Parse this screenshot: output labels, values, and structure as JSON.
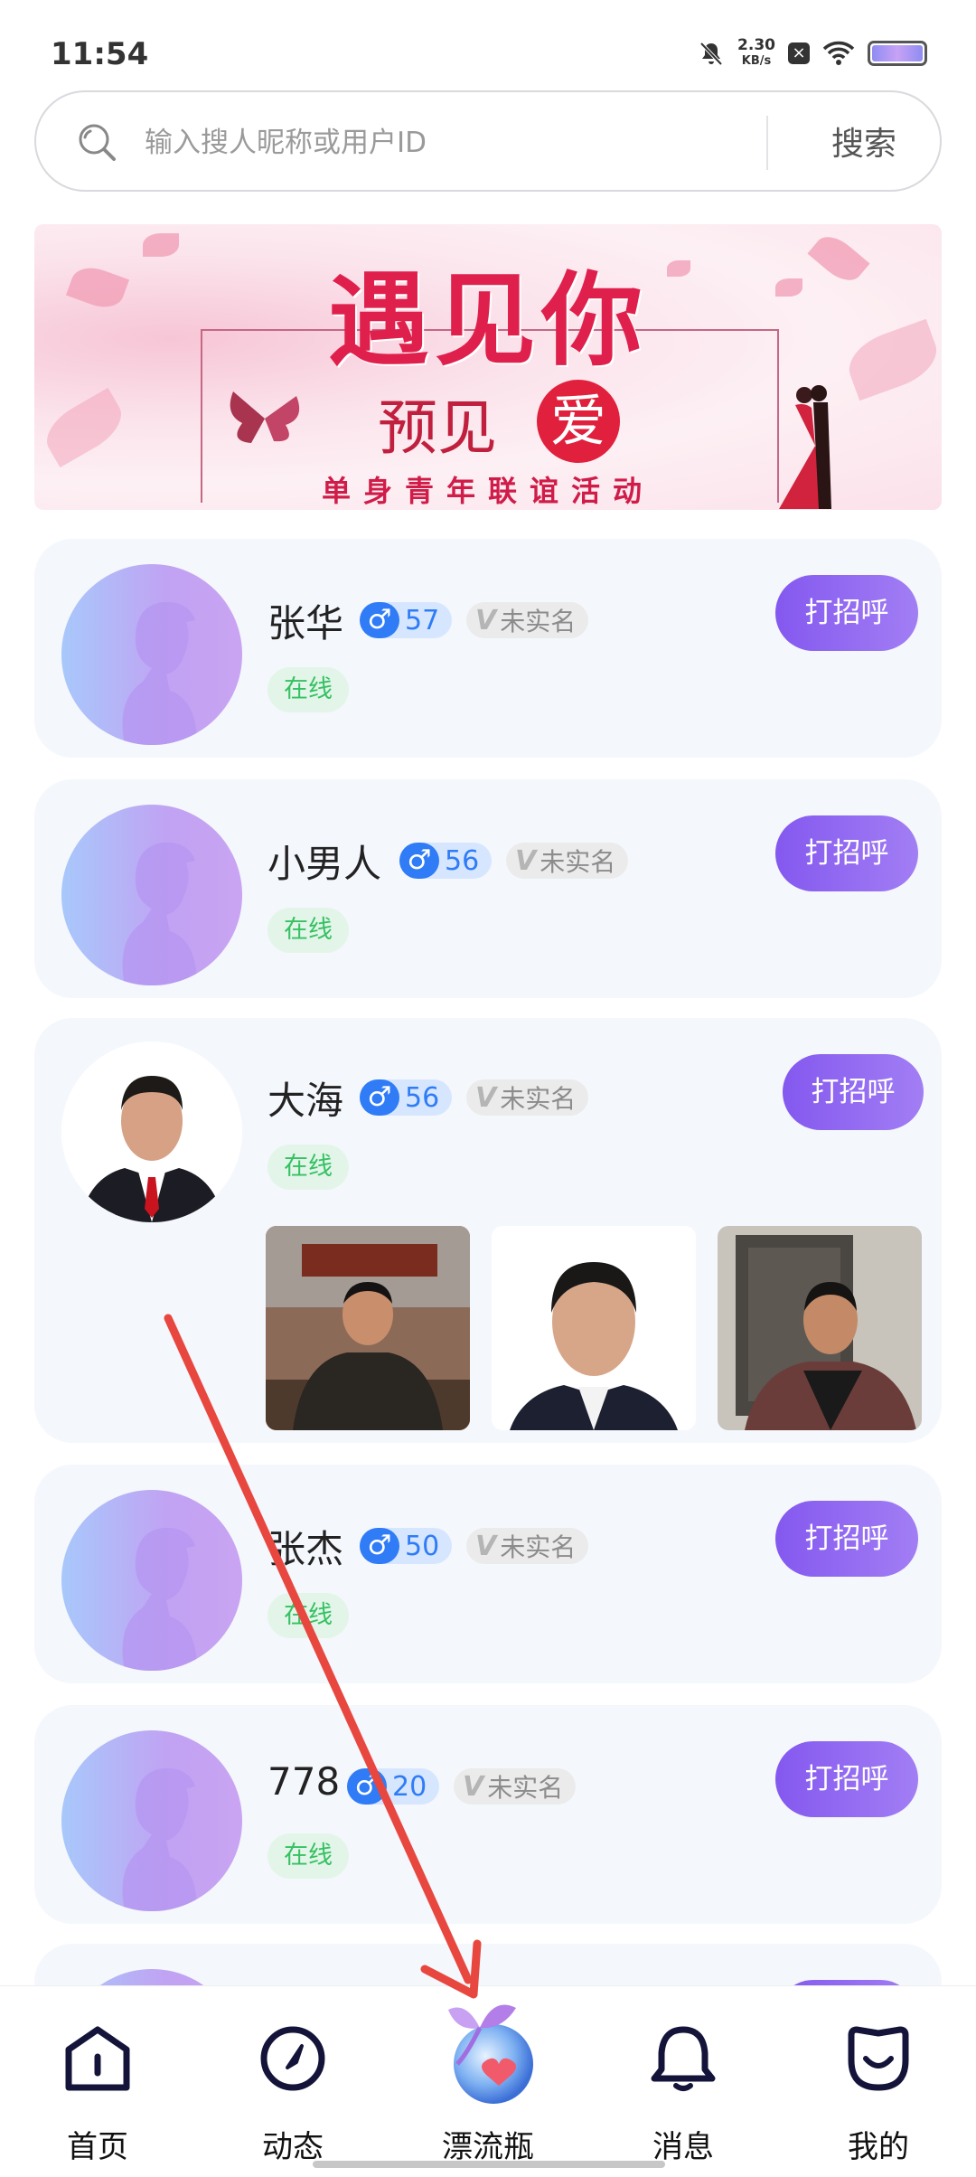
{
  "status_bar": {
    "time": "11:54",
    "net_speed_value": "2.30",
    "net_speed_unit": "KB/s"
  },
  "search": {
    "placeholder": "输入搜人昵称或用户ID",
    "button_label": "搜索"
  },
  "banner": {
    "title": "遇见你",
    "subtitle": "预见",
    "subtitle_highlight": "爱",
    "caption": "单身青年联谊活动"
  },
  "users": [
    {
      "name": "张华",
      "gender_symbol": "♂",
      "age": "57",
      "verify_mark": "V",
      "verify_label": "未实名",
      "status": "在线",
      "greet_label": "打招呼"
    },
    {
      "name": "小男人",
      "gender_symbol": "♂",
      "age": "56",
      "verify_mark": "V",
      "verify_label": "未实名",
      "status": "在线",
      "greet_label": "打招呼"
    },
    {
      "name": "大海",
      "gender_symbol": "♂",
      "age": "56",
      "verify_mark": "V",
      "verify_label": "未实名",
      "status": "在线",
      "greet_label": "打招呼"
    },
    {
      "name": "张杰",
      "gender_symbol": "♂",
      "age": "50",
      "verify_mark": "V",
      "verify_label": "未实名",
      "status": "在线",
      "greet_label": "打招呼"
    },
    {
      "name": "778",
      "gender_symbol": "♂",
      "age": "20",
      "verify_mark": "V",
      "verify_label": "未实名",
      "status": "在线",
      "greet_label": "打招呼"
    }
  ],
  "bottom_nav": [
    {
      "label": "首页",
      "icon": "home-icon"
    },
    {
      "label": "动态",
      "icon": "compass-icon"
    },
    {
      "label": "漂流瓶",
      "icon": "drift-bottle-icon"
    },
    {
      "label": "消息",
      "icon": "bell-icon"
    },
    {
      "label": "我的",
      "icon": "profile-icon"
    }
  ],
  "colors": {
    "accent_purple": "#8458ef",
    "gender_blue": "#2f7cf6",
    "online_green": "#35c163",
    "card_bg": "#f4f7fc",
    "annotation_red": "#e8473f"
  }
}
